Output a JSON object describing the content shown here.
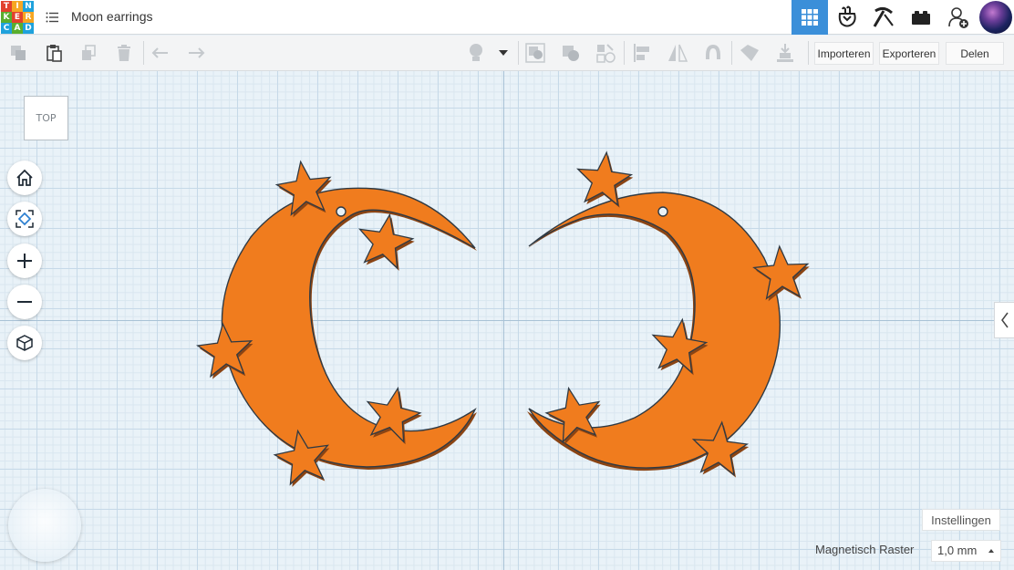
{
  "app": {
    "logo_letters": [
      "T",
      "I",
      "N",
      "K",
      "E",
      "R",
      "C",
      "A",
      "D"
    ],
    "logo_colors": [
      "#e2412d",
      "#f6a623",
      "#1fa2dc",
      "#5aae2e",
      "#e2412d",
      "#f6a623",
      "#1fa2dc",
      "#5aae2e",
      "#1fa2dc"
    ],
    "design_title": "Moon earrings"
  },
  "toolbar": {
    "import_label": "Importeren",
    "export_label": "Exporteren",
    "share_label": "Delen"
  },
  "viewcube": {
    "label": "TOP"
  },
  "workplane": {
    "settings_label": "Instellingen",
    "snap_grid_label": "Magnetisch Raster",
    "snap_grid_value": "1,0 mm"
  },
  "colors": {
    "shape_fill": "#f07c1e",
    "shape_outline": "#2f3a44",
    "accent": "#3b8fd9"
  },
  "icons": {
    "menu": "list-icon",
    "views": [
      "grid-view-icon",
      "blocks-view-icon",
      "pickaxe-icon",
      "bricks-icon"
    ],
    "user": "add-user-icon"
  }
}
